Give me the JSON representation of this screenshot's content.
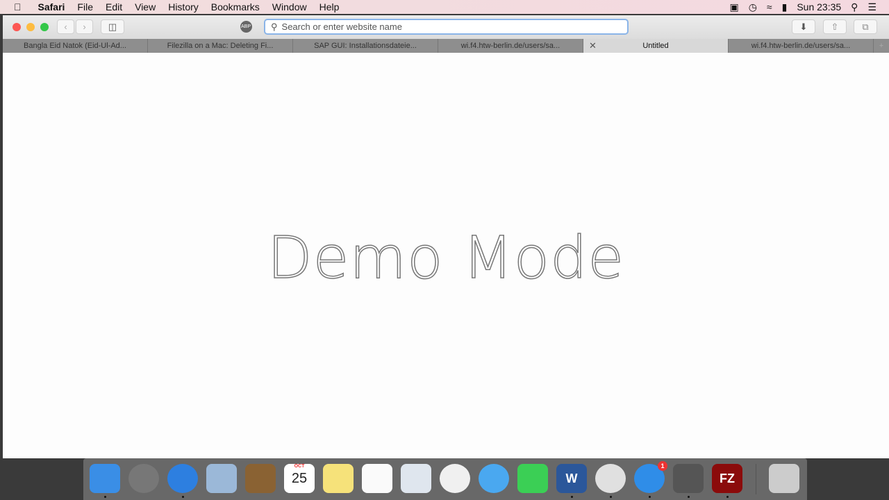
{
  "menubar": {
    "app": "Safari",
    "items": [
      "File",
      "Edit",
      "View",
      "History",
      "Bookmarks",
      "Window",
      "Help"
    ],
    "clock": "Sun 23:35"
  },
  "toolbar": {
    "url_placeholder": "Search or enter website name",
    "adblock": "ABP"
  },
  "tabs": [
    {
      "label": "Bangla Eid Natok (Eid-Ul-Ad..."
    },
    {
      "label": "Filezilla on a Mac: Deleting Fi..."
    },
    {
      "label": "SAP GUI: Installationsdateie..."
    },
    {
      "label": "wi.f4.htw-berlin.de/users/sa..."
    },
    {
      "label": "Untitled",
      "active": true
    },
    {
      "label": "wi.f4.htw-berlin.de/users/sa..."
    }
  ],
  "content": {
    "demo_text": "Demo Mode"
  },
  "dock": {
    "items": [
      {
        "name": "finder",
        "color": "#3a8ee6"
      },
      {
        "name": "launchpad",
        "color": "#777"
      },
      {
        "name": "safari",
        "color": "#2d7fe0"
      },
      {
        "name": "mail",
        "color": "#9bb8d8"
      },
      {
        "name": "contacts",
        "color": "#8a6233"
      },
      {
        "name": "calendar",
        "color": "#ffffff",
        "label": "25",
        "month": "OCT"
      },
      {
        "name": "notes",
        "color": "#f6e27a"
      },
      {
        "name": "reminders",
        "color": "#fafafa"
      },
      {
        "name": "preview",
        "color": "#dfe6ee"
      },
      {
        "name": "photos",
        "color": "#f0f0f0"
      },
      {
        "name": "messages",
        "color": "#4aa8f0"
      },
      {
        "name": "facetime",
        "color": "#3bcf55"
      },
      {
        "name": "word",
        "color": "#2b579a",
        "label": "W"
      },
      {
        "name": "chrome",
        "color": "#e0e0e0"
      },
      {
        "name": "app-store",
        "color": "#2f8de8",
        "badge": "1"
      },
      {
        "name": "system-preferences",
        "color": "#555"
      },
      {
        "name": "filezilla",
        "color": "#8b0b0b",
        "label": "FZ"
      },
      {
        "name": "trash",
        "color": "#ccc"
      }
    ]
  }
}
